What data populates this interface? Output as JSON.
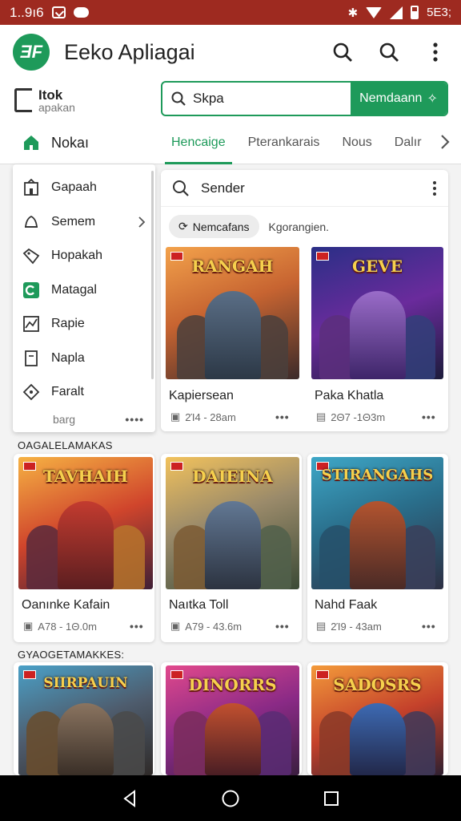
{
  "status_bar": {
    "time": "1..9ı6",
    "battery_text": "5E3;"
  },
  "app_bar": {
    "logo_text": "ƎF",
    "title": "Eeko Apliagai"
  },
  "brand": {
    "line1": "Itok",
    "line2": "apakan"
  },
  "search": {
    "value": "Skpa",
    "button_label": "Nemdaann"
  },
  "home_tab": {
    "label": "Nokaı"
  },
  "tabs": [
    {
      "label": "Hencaige",
      "active": true
    },
    {
      "label": "Pterankarais",
      "active": false
    },
    {
      "label": "Nous",
      "active": false
    },
    {
      "label": "Dalır",
      "active": false
    }
  ],
  "menu": {
    "items": [
      {
        "label": "Gapaah",
        "icon": "building-icon"
      },
      {
        "label": "Semem",
        "icon": "bell-icon"
      },
      {
        "label": "Hopakah",
        "icon": "tag-icon"
      },
      {
        "label": "Matagal",
        "icon": "green-app-icon"
      },
      {
        "label": "Rapie",
        "icon": "chart-icon"
      },
      {
        "label": "Napla",
        "icon": "document-icon"
      },
      {
        "label": "Faralt",
        "icon": "diamond-icon"
      }
    ],
    "footer": "barg"
  },
  "panel": {
    "search_label": "Sender",
    "chip_label": "Nemcafans",
    "chip_plain": "Kgorangien."
  },
  "sections": {
    "first": "OAGALELAMAKAS",
    "second": "GYAOGETAMAKKES:"
  },
  "cards": [
    {
      "image_title": "RANGAH",
      "title": "Kapiersean",
      "meta": "2Ί4 - 28am"
    },
    {
      "image_title": "GEVE",
      "title": "Paka Khatla",
      "meta": "2Θ7 -1Θ3m"
    },
    {
      "image_title": "TAVHAIH",
      "title": "Oanınke Kafain",
      "meta": "A78 - 1Θ.0m"
    },
    {
      "image_title": "DAIEINA",
      "title": "Naıtka Toll",
      "meta": "A79 - 43.6m"
    },
    {
      "image_title": "STIRANGAHS",
      "title": "Nahd Faak",
      "meta": "2Ί9 - 43am"
    },
    {
      "image_title": "SIIRPAUIN",
      "title": "",
      "meta": ""
    },
    {
      "image_title": "DINORRS",
      "title": "",
      "meta": ""
    },
    {
      "image_title": "SADOSRS",
      "title": "",
      "meta": ""
    }
  ],
  "colors": {
    "accent": "#1e9a5a",
    "status_bar": "#9e2a20"
  }
}
